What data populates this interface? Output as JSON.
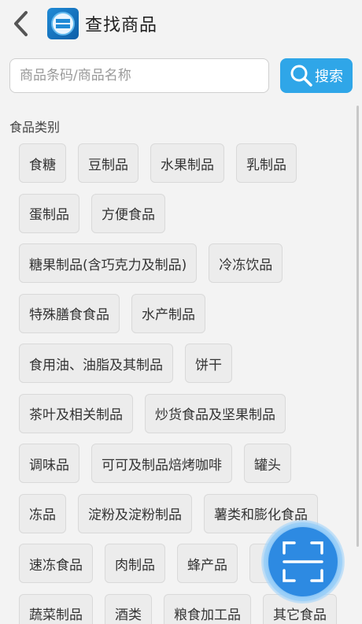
{
  "header": {
    "title": "查找商品",
    "back_icon": "chevron-left-icon",
    "logo_icon": "app-logo-icon"
  },
  "search": {
    "placeholder": "商品条码/商品名称",
    "value": "",
    "button_label": "搜索",
    "button_icon": "search-icon",
    "accent_color": "#2fa6e8"
  },
  "categories": {
    "label": "食品类别",
    "rows": [
      [
        "食糖",
        "豆制品",
        "水果制品",
        "乳制品"
      ],
      [
        "蛋制品",
        "方便食品"
      ],
      [
        "糖果制品(含巧克力及制品)",
        "冷冻饮品"
      ],
      [
        "特殊膳食食品",
        "水产制品"
      ],
      [
        "食用油、油脂及其制品",
        "饼干"
      ],
      [
        "茶叶及相关制品",
        "炒货食品及坚果制品"
      ],
      [
        "调味品",
        "可可及制品焙烤咖啡",
        "罐头"
      ],
      [
        "冻品",
        "淀粉及淀粉制品",
        "薯类和膨化食品"
      ],
      [
        "速冻食品",
        "肉制品",
        "蜂产品",
        ""
      ],
      [
        "蔬菜制品",
        "酒类",
        "粮食加工品",
        "其它食品"
      ]
    ]
  },
  "fab": {
    "icon": "scan-icon",
    "color": "#2d8ae2"
  }
}
